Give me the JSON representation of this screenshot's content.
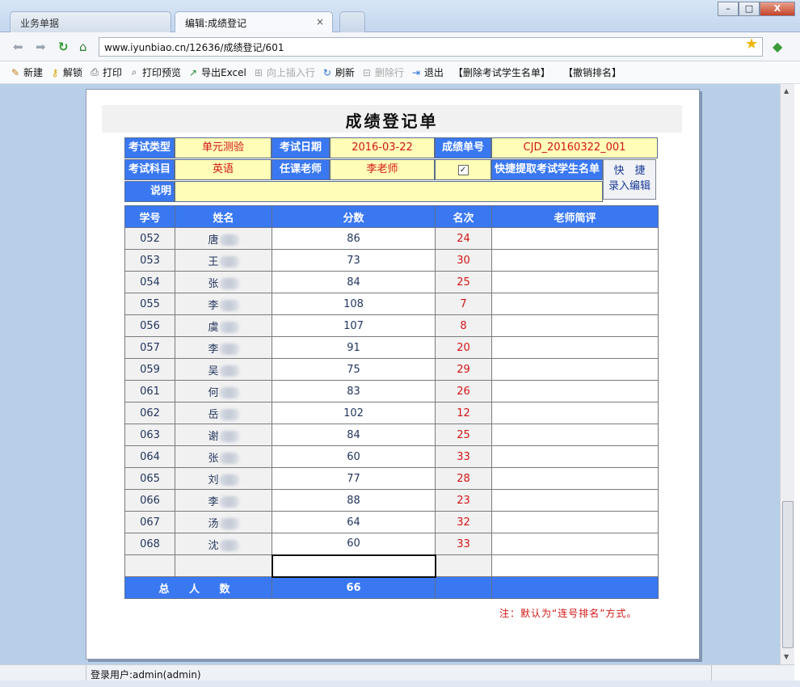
{
  "tabs": {
    "inactive": "业务单据",
    "active": "编辑:成绩登记",
    "close_glyph": "×"
  },
  "window": {
    "minimize": "–",
    "maximize": "□",
    "close": "X"
  },
  "address": {
    "url": "www.iyunbiao.cn/12636/成绩登记/601"
  },
  "toolbar": {
    "new": "新建",
    "unlock": "解锁",
    "print": "打印",
    "print_preview": "打印预览",
    "export_excel": "导出Excel",
    "insert_row_above": "向上插入行",
    "refresh": "刷新",
    "delete_row": "删除行",
    "exit": "退出",
    "delete_student_list": "【删除考试学生名单】",
    "cancel_ranking": "【撤销排名】"
  },
  "document": {
    "title": "成绩登记单",
    "fields": {
      "exam_type_label": "考试类型",
      "exam_type": "单元测验",
      "exam_date_label": "考试日期",
      "exam_date": "2016-03-22",
      "score_no_label": "成绩单号",
      "score_no": "CJD_20160322_001",
      "subject_label": "考试科目",
      "subject": "英语",
      "teacher_label": "任课老师",
      "teacher": "李老师",
      "quick_fetch_checked": "✓",
      "quick_fetch_label": "快捷提取考试学生名单",
      "remark_label": "说明",
      "remark": ""
    },
    "quick_entry_button": {
      "line1": "快　捷",
      "line2": "录入编辑"
    },
    "columns": [
      "学号",
      "姓名",
      "分数",
      "名次",
      "老师简评"
    ],
    "rows": [
      {
        "id": "052",
        "name": "唐",
        "score": "86",
        "rank": "24",
        "comment": ""
      },
      {
        "id": "053",
        "name": "王",
        "score": "73",
        "rank": "30",
        "comment": ""
      },
      {
        "id": "054",
        "name": "张",
        "score": "84",
        "rank": "25",
        "comment": ""
      },
      {
        "id": "055",
        "name": "李",
        "score": "108",
        "rank": "7",
        "comment": ""
      },
      {
        "id": "056",
        "name": "虞",
        "score": "107",
        "rank": "8",
        "comment": ""
      },
      {
        "id": "057",
        "name": "李",
        "score": "91",
        "rank": "20",
        "comment": ""
      },
      {
        "id": "059",
        "name": "吴",
        "score": "75",
        "rank": "29",
        "comment": ""
      },
      {
        "id": "061",
        "name": "何",
        "score": "83",
        "rank": "26",
        "comment": ""
      },
      {
        "id": "062",
        "name": "岳",
        "score": "102",
        "rank": "12",
        "comment": ""
      },
      {
        "id": "063",
        "name": "谢",
        "score": "84",
        "rank": "25",
        "comment": ""
      },
      {
        "id": "064",
        "name": "张",
        "score": "60",
        "rank": "33",
        "comment": ""
      },
      {
        "id": "065",
        "name": "刘",
        "score": "77",
        "rank": "28",
        "comment": ""
      },
      {
        "id": "066",
        "name": "李",
        "score": "88",
        "rank": "23",
        "comment": ""
      },
      {
        "id": "067",
        "name": "汤",
        "score": "64",
        "rank": "32",
        "comment": ""
      },
      {
        "id": "068",
        "name": "沈",
        "score": "60",
        "rank": "33",
        "comment": ""
      }
    ],
    "total_label": "总 人 数",
    "total_count": "66",
    "note": "注：默认为“连号排名”方式。"
  },
  "status": {
    "login_user": "登录用户:admin(admin)"
  },
  "colors": {
    "header_blue": "#3a78f2",
    "value_yellow": "#fffdb8",
    "rank_red": "#d21414",
    "workspace_blue": "#b8cfe9"
  },
  "icons": {
    "back": "back-arrow-icon",
    "forward": "forward-arrow-icon",
    "reload": "reload-icon",
    "home": "home-icon",
    "bookmark": "star-icon",
    "extension": "extension-icon"
  }
}
